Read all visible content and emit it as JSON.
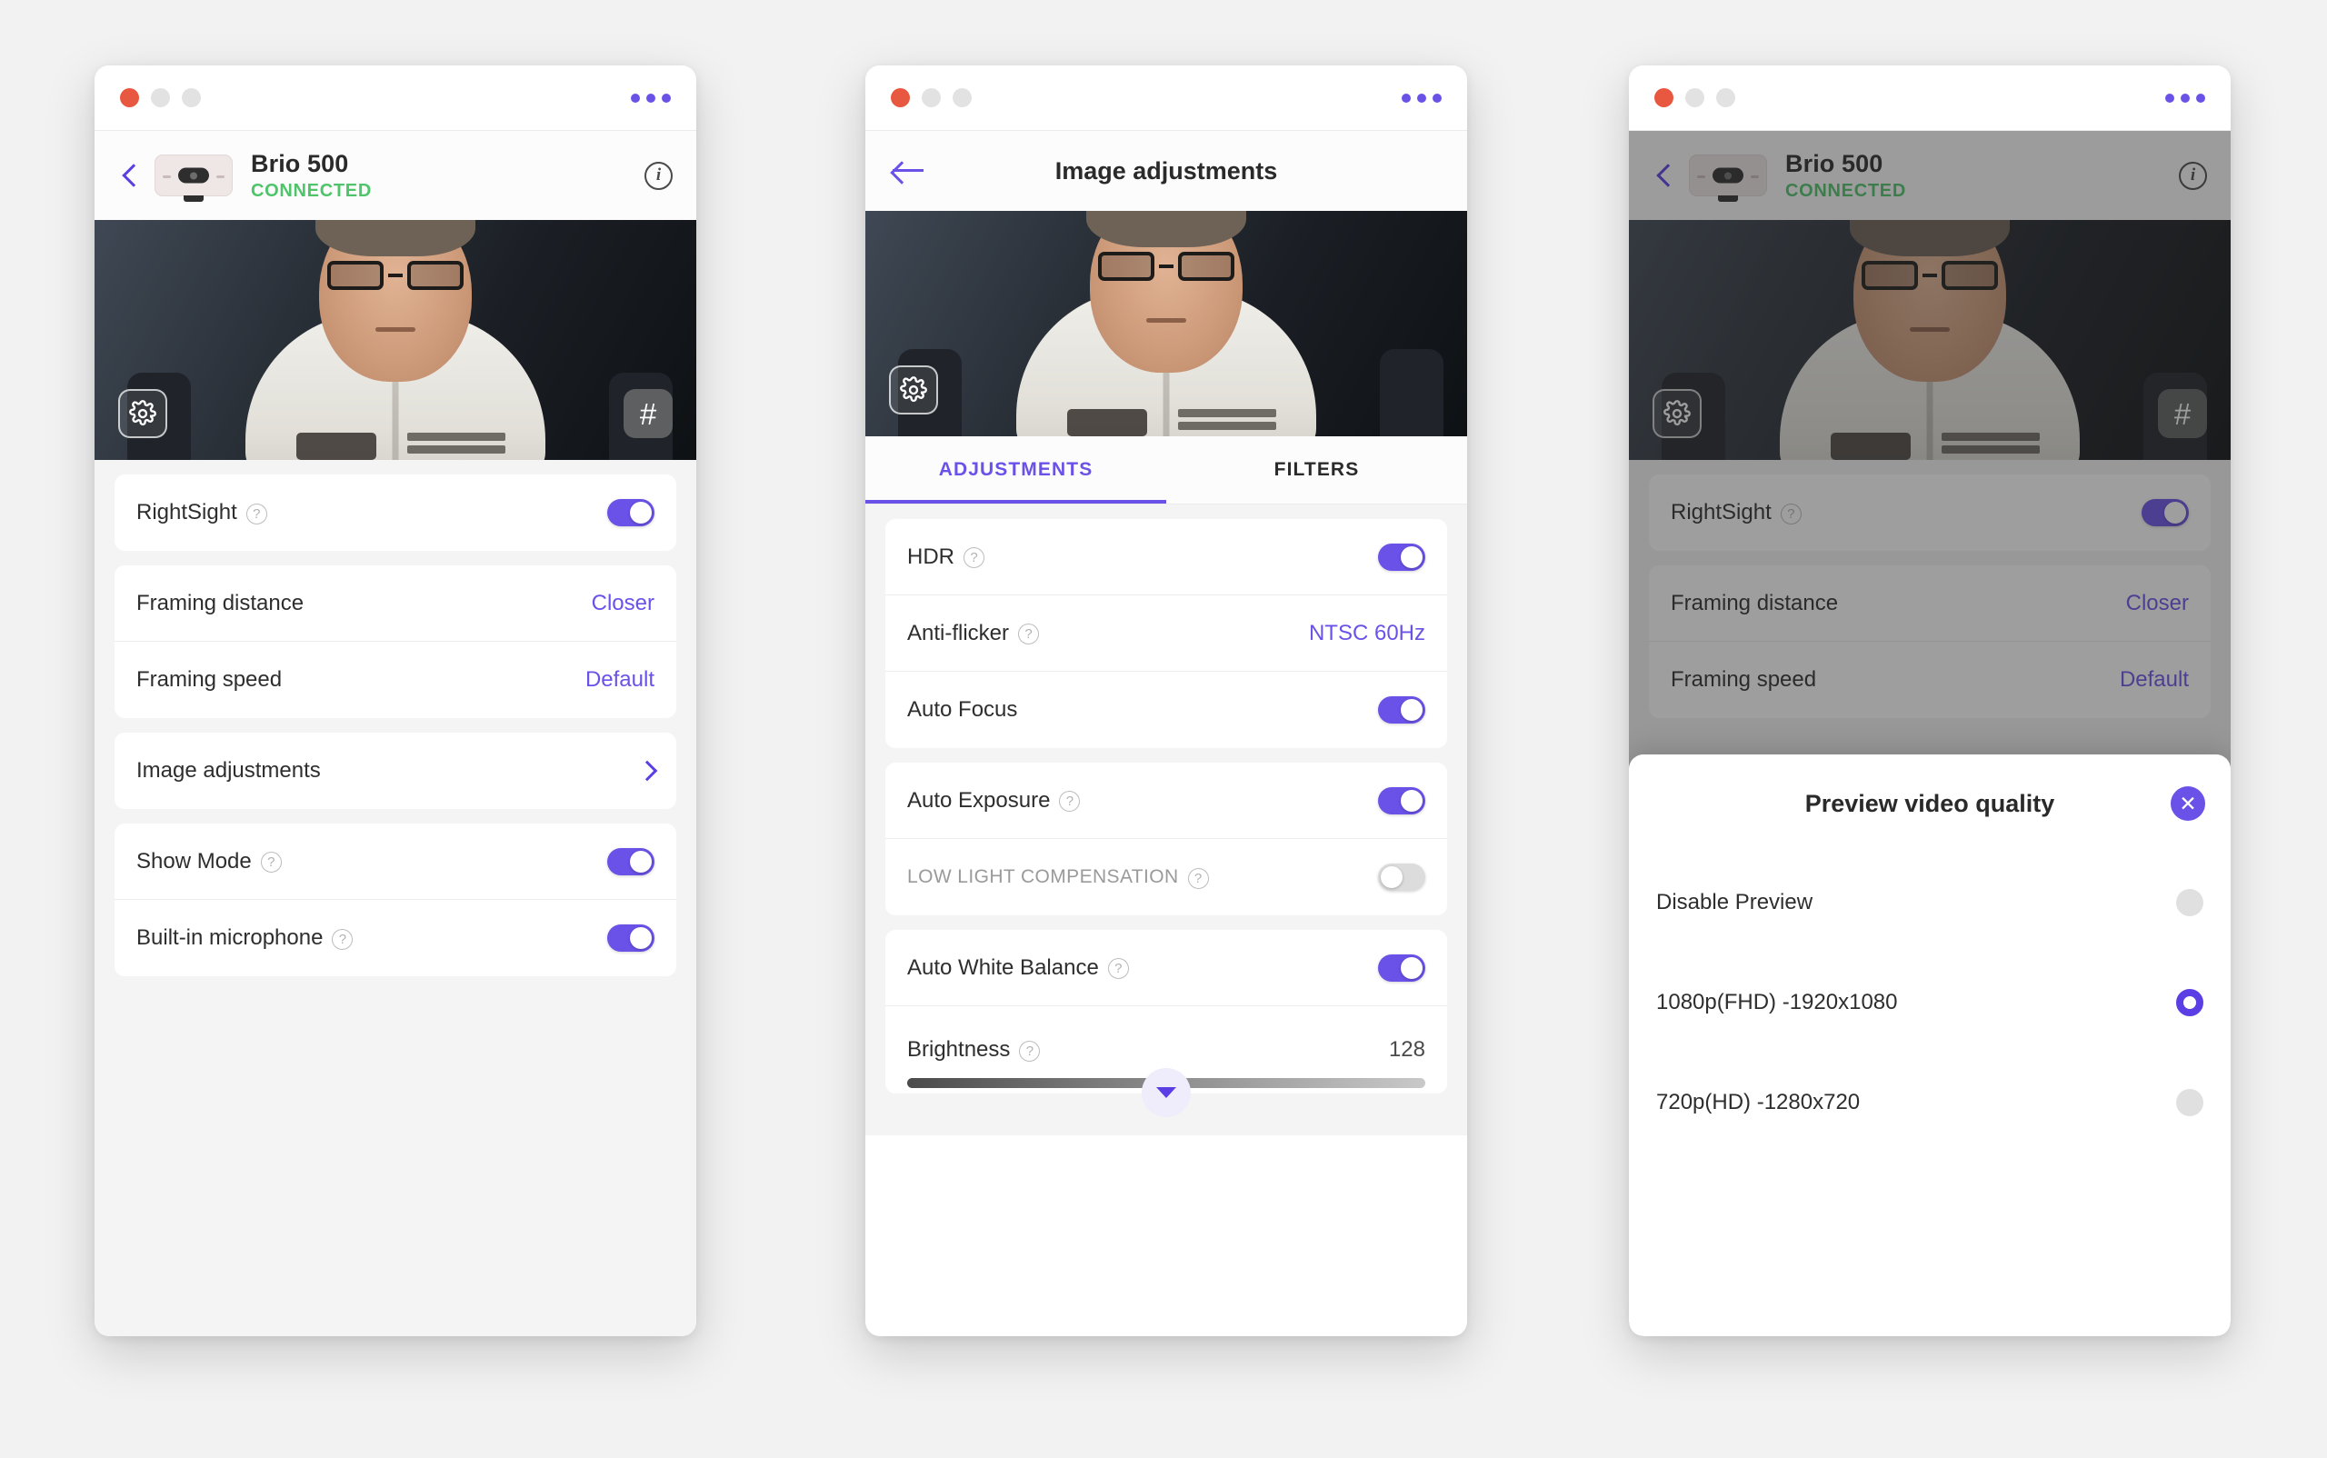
{
  "window_controls": {
    "close_label": "close",
    "minimize_label": "minimize",
    "maximize_label": "maximize",
    "menu_label": "more-options"
  },
  "colors": {
    "accent": "#6a52e8",
    "accent_dark": "#5b3fe4",
    "status_connected": "#4fc46b",
    "toggle_off": "#dcdcdc",
    "close_dot": "#e8573f"
  },
  "device": {
    "name": "Brio 500",
    "status": "CONNECTED",
    "thumbnail_icon": "webcam-icon",
    "back_icon": "chevron-left-icon",
    "info_icon": "info-icon"
  },
  "video_preview": {
    "settings_icon": "gear-icon",
    "grid_icon": "grid-icon"
  },
  "panel1": {
    "groups": [
      {
        "rows": [
          {
            "label": "RightSight",
            "help": "?",
            "control": "toggle",
            "state": "on"
          }
        ]
      },
      {
        "rows": [
          {
            "label": "Framing distance",
            "control": "value",
            "value": "Closer"
          },
          {
            "label": "Framing speed",
            "control": "value",
            "value": "Default"
          }
        ]
      },
      {
        "rows": [
          {
            "label": "Image adjustments",
            "control": "chevron"
          }
        ]
      },
      {
        "rows": [
          {
            "label": "Show Mode",
            "help": "?",
            "control": "toggle",
            "state": "on"
          },
          {
            "label": "Built-in microphone",
            "help": "?",
            "control": "toggle",
            "state": "on"
          }
        ]
      }
    ]
  },
  "panel2": {
    "title": "Image adjustments",
    "back_icon": "arrow-left-icon",
    "tabs": [
      {
        "label": "ADJUSTMENTS",
        "active": true
      },
      {
        "label": "FILTERS",
        "active": false
      }
    ],
    "groups": [
      {
        "rows": [
          {
            "label": "HDR",
            "help": "?",
            "control": "toggle",
            "state": "on"
          },
          {
            "label": "Anti-flicker",
            "help": "?",
            "control": "value",
            "value": "NTSC 60Hz"
          },
          {
            "label": "Auto Focus",
            "control": "toggle",
            "state": "on"
          }
        ]
      },
      {
        "rows": [
          {
            "label": "Auto Exposure",
            "help": "?",
            "control": "toggle",
            "state": "on"
          },
          {
            "label": "LOW LIGHT COMPENSATION",
            "help": "?",
            "control": "toggle",
            "state": "off",
            "sub": true
          }
        ]
      },
      {
        "rows": [
          {
            "label": "Auto White Balance",
            "help": "?",
            "control": "toggle",
            "state": "on"
          },
          {
            "label": "Brightness",
            "help": "?",
            "control": "number",
            "value": "128"
          }
        ]
      }
    ],
    "scroll_hint_icon": "chevron-down-icon"
  },
  "panel3": {
    "modal": {
      "title": "Preview video quality",
      "close_icon": "close-icon",
      "options": [
        {
          "label": "Disable Preview",
          "selected": false
        },
        {
          "label": "1080p(FHD) -1920x1080",
          "selected": true
        },
        {
          "label": "720p(HD) -1280x720",
          "selected": false
        }
      ]
    }
  }
}
